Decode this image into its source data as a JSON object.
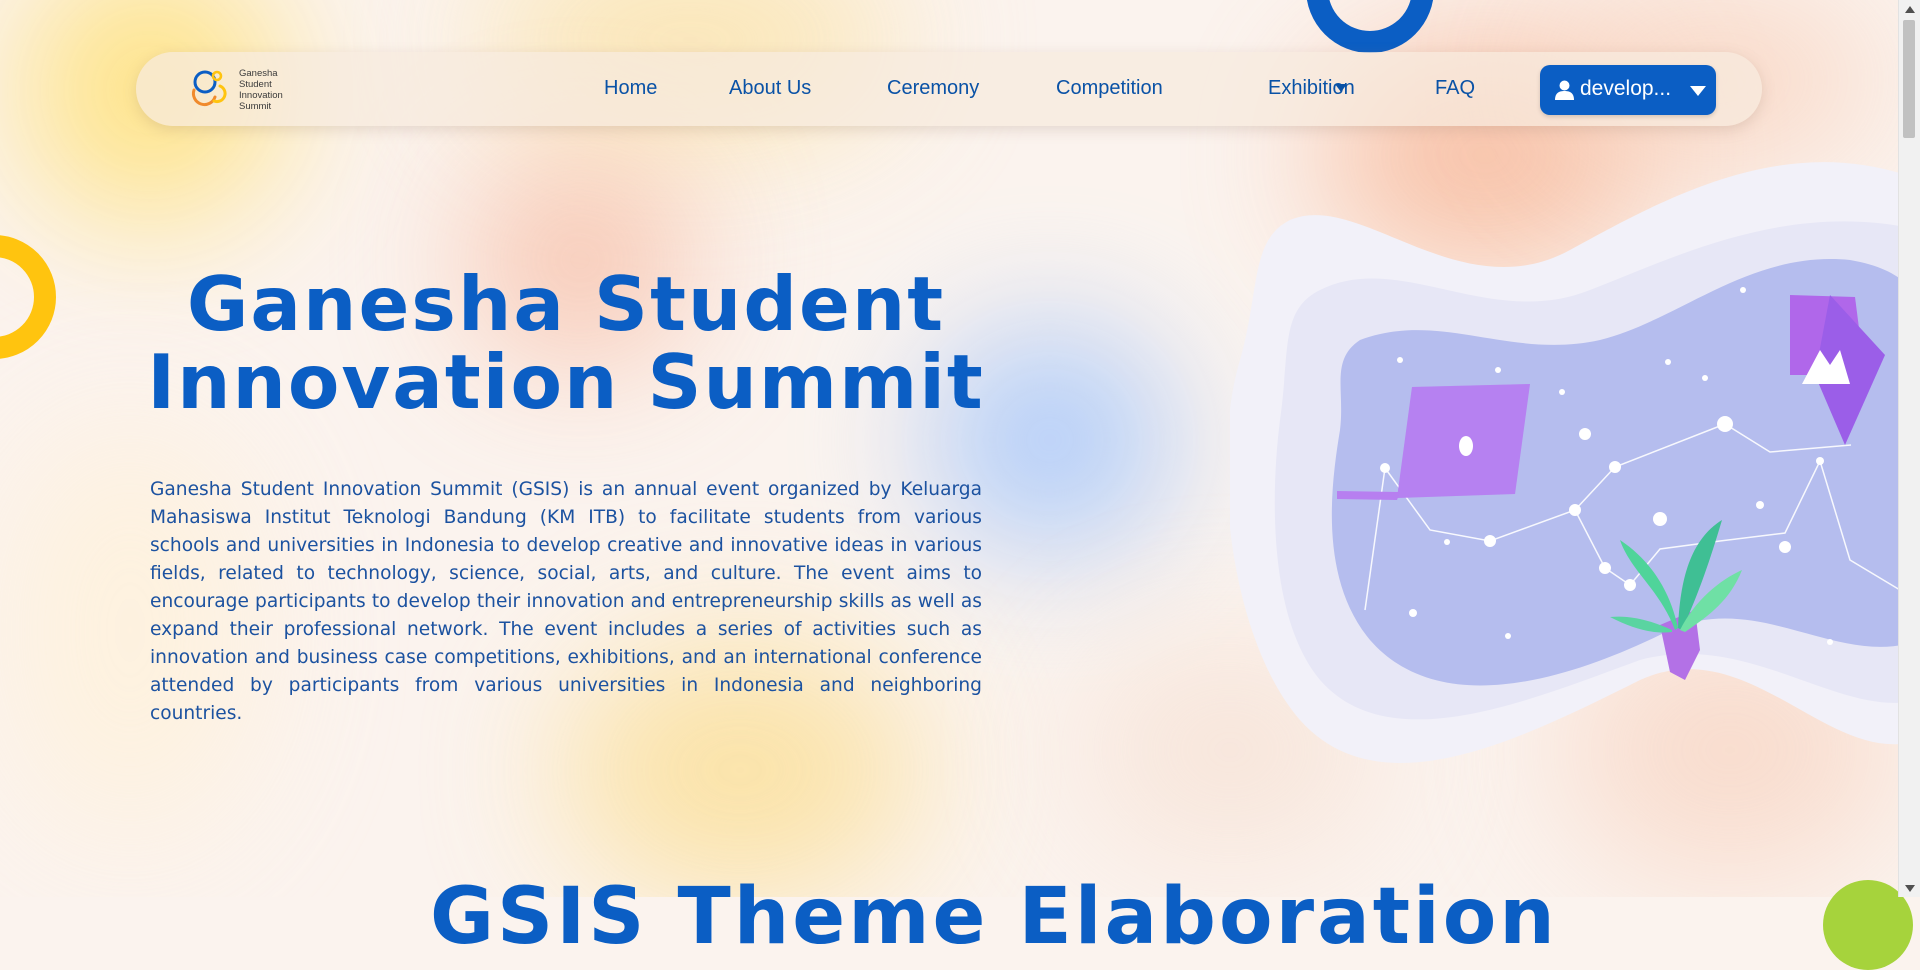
{
  "brand": {
    "logo_lines": [
      "Ganesha",
      "Student",
      "Innovation",
      "Summit"
    ],
    "colors": {
      "primary": "#0b5ec4",
      "text": "#0a52a6",
      "accent_yellow": "#ffc40f",
      "accent_orange": "#f08a2c",
      "accent_green": "#a6d33c"
    }
  },
  "nav": {
    "items": [
      {
        "label": "Home"
      },
      {
        "label": "About Us"
      },
      {
        "label": "Ceremony"
      },
      {
        "label": "Competition",
        "icon": "caret-down-icon"
      },
      {
        "label": "Exhibition"
      },
      {
        "label": "FAQ"
      }
    ],
    "user_button": {
      "label": "develop...",
      "icon": "user-icon",
      "caret": "caret-down-icon"
    }
  },
  "hero": {
    "title_line1": "Ganesha Student",
    "title_line2": "Innovation Summit",
    "description": "Ganesha Student Innovation Summit (GSIS) is an annual event organized by Keluarga Mahasiswa Institut Teknologi Bandung (KM ITB) to facilitate students from various schools and universities in Indonesia to develop creative and innovative ideas in various fields, related to technology, science, social, arts, and culture. The event aims to encourage participants to develop their innovation and entrepreneurship skills as well as expand their professional network. The event includes a series of activities such as innovation and business case competitions, exhibitions, and an international conference attended by participants from various universities in Indonesia and neighboring countries."
  },
  "next_section": {
    "heading": "GSIS Theme Elaboration"
  }
}
